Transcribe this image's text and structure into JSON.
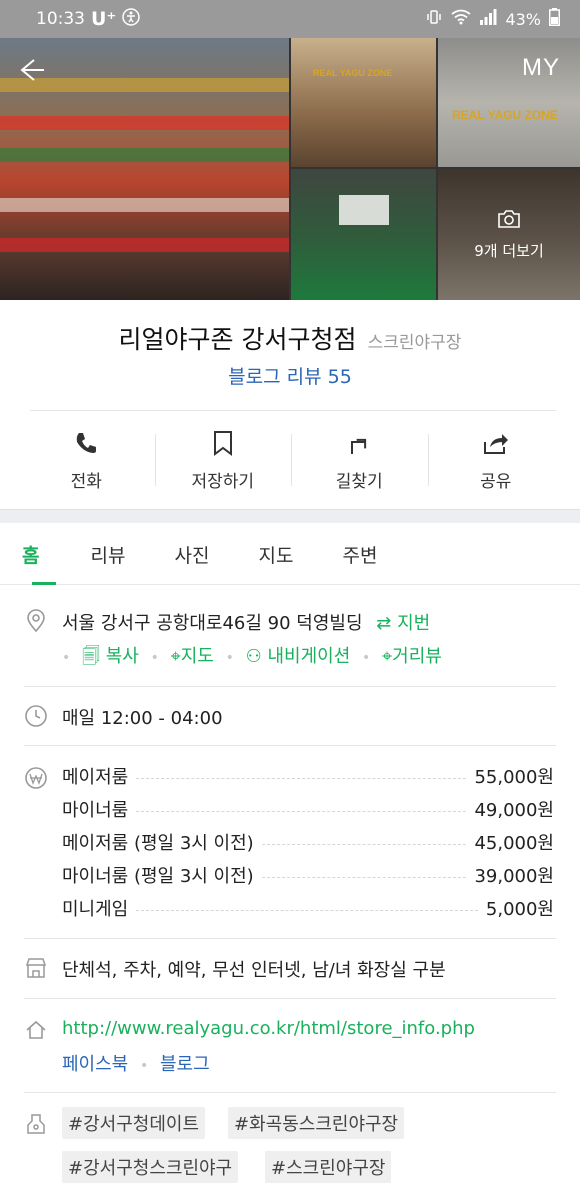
{
  "status_bar": {
    "time": "10:33",
    "carrier": "U⁺",
    "battery": "43%"
  },
  "header": {
    "my_label": "MY",
    "more_photos_label": "9개 더보기",
    "zone_sign_a": "REAL YAGU ZONE",
    "zone_sign_b": "REAL YAGU ZONE"
  },
  "place": {
    "name": "리얼야구존 강서구청점",
    "category": "스크린야구장",
    "blog_review": "블로그 리뷰 55"
  },
  "actions": [
    {
      "label": "전화",
      "icon": "phone-icon"
    },
    {
      "label": "저장하기",
      "icon": "bookmark-icon"
    },
    {
      "label": "길찾기",
      "icon": "directions-icon"
    },
    {
      "label": "공유",
      "icon": "share-icon"
    }
  ],
  "tabs": [
    "홈",
    "리뷰",
    "사진",
    "지도",
    "주변"
  ],
  "address": {
    "text": "서울 강서구 공항대로46길 90 덕영빌딩",
    "jibun_label": "지번",
    "links": [
      "복사",
      "지도",
      "내비게이션",
      "거리뷰"
    ]
  },
  "hours": "매일 12:00 - 04:00",
  "prices": [
    {
      "name": "메이저룸",
      "price": "55,000원"
    },
    {
      "name": "마이너룸",
      "price": "49,000원"
    },
    {
      "name": "메이저룸 (평일 3시 이전)",
      "price": "45,000원"
    },
    {
      "name": "마이너룸 (평일 3시 이전)",
      "price": "39,000원"
    },
    {
      "name": "미니게임",
      "price": "5,000원"
    }
  ],
  "amenities": "단체석, 주차, 예약, 무선 인터넷, 남/녀 화장실 구분",
  "homepage": {
    "url": "http://www.realyagu.co.kr/html/store_info.php",
    "links": [
      "페이스북",
      "블로그"
    ]
  },
  "tags": [
    "#강서구청데이트",
    "#화곡동스크린야구장",
    "#강서구청스크린야구",
    "#스크린야구장"
  ],
  "colors": {
    "accent_green": "#19b15c",
    "link_blue": "#2a66b8",
    "status_bar": "#9a9a9a"
  }
}
